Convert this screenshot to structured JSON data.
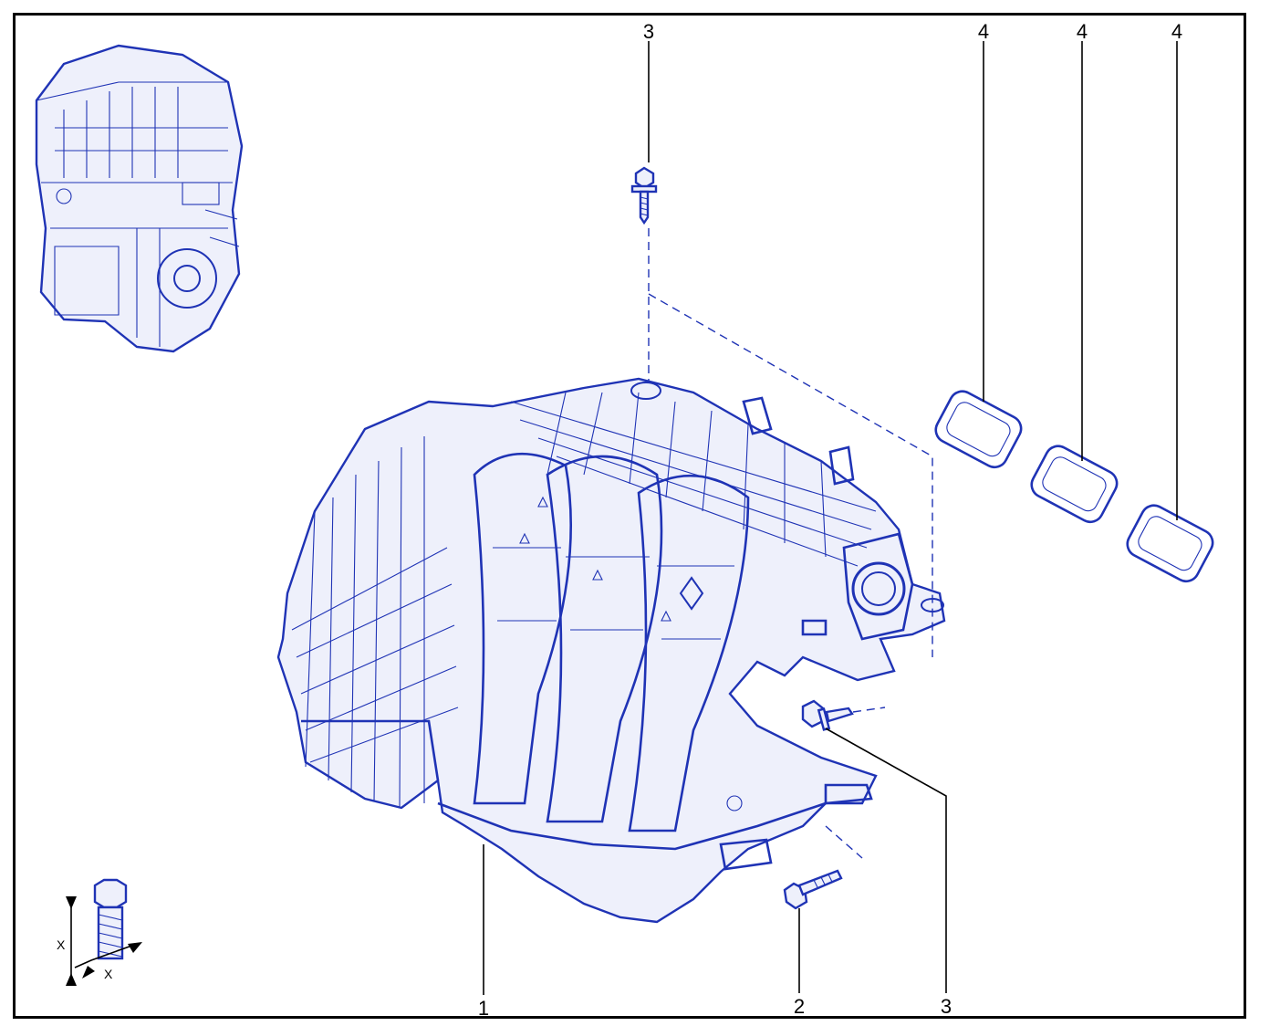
{
  "colors": {
    "line": "#1f33b5",
    "leader": "#000000",
    "background": "#ffffff"
  },
  "callouts": {
    "manifold": "1",
    "long_bolt": "2",
    "bolt_top": "3",
    "bolt_mid": "3",
    "gasket_1": "4",
    "gasket_2": "4",
    "gasket_3": "4"
  },
  "tightening_symbol": {
    "dimension_vertical": "X",
    "dimension_horizontal": "X"
  }
}
